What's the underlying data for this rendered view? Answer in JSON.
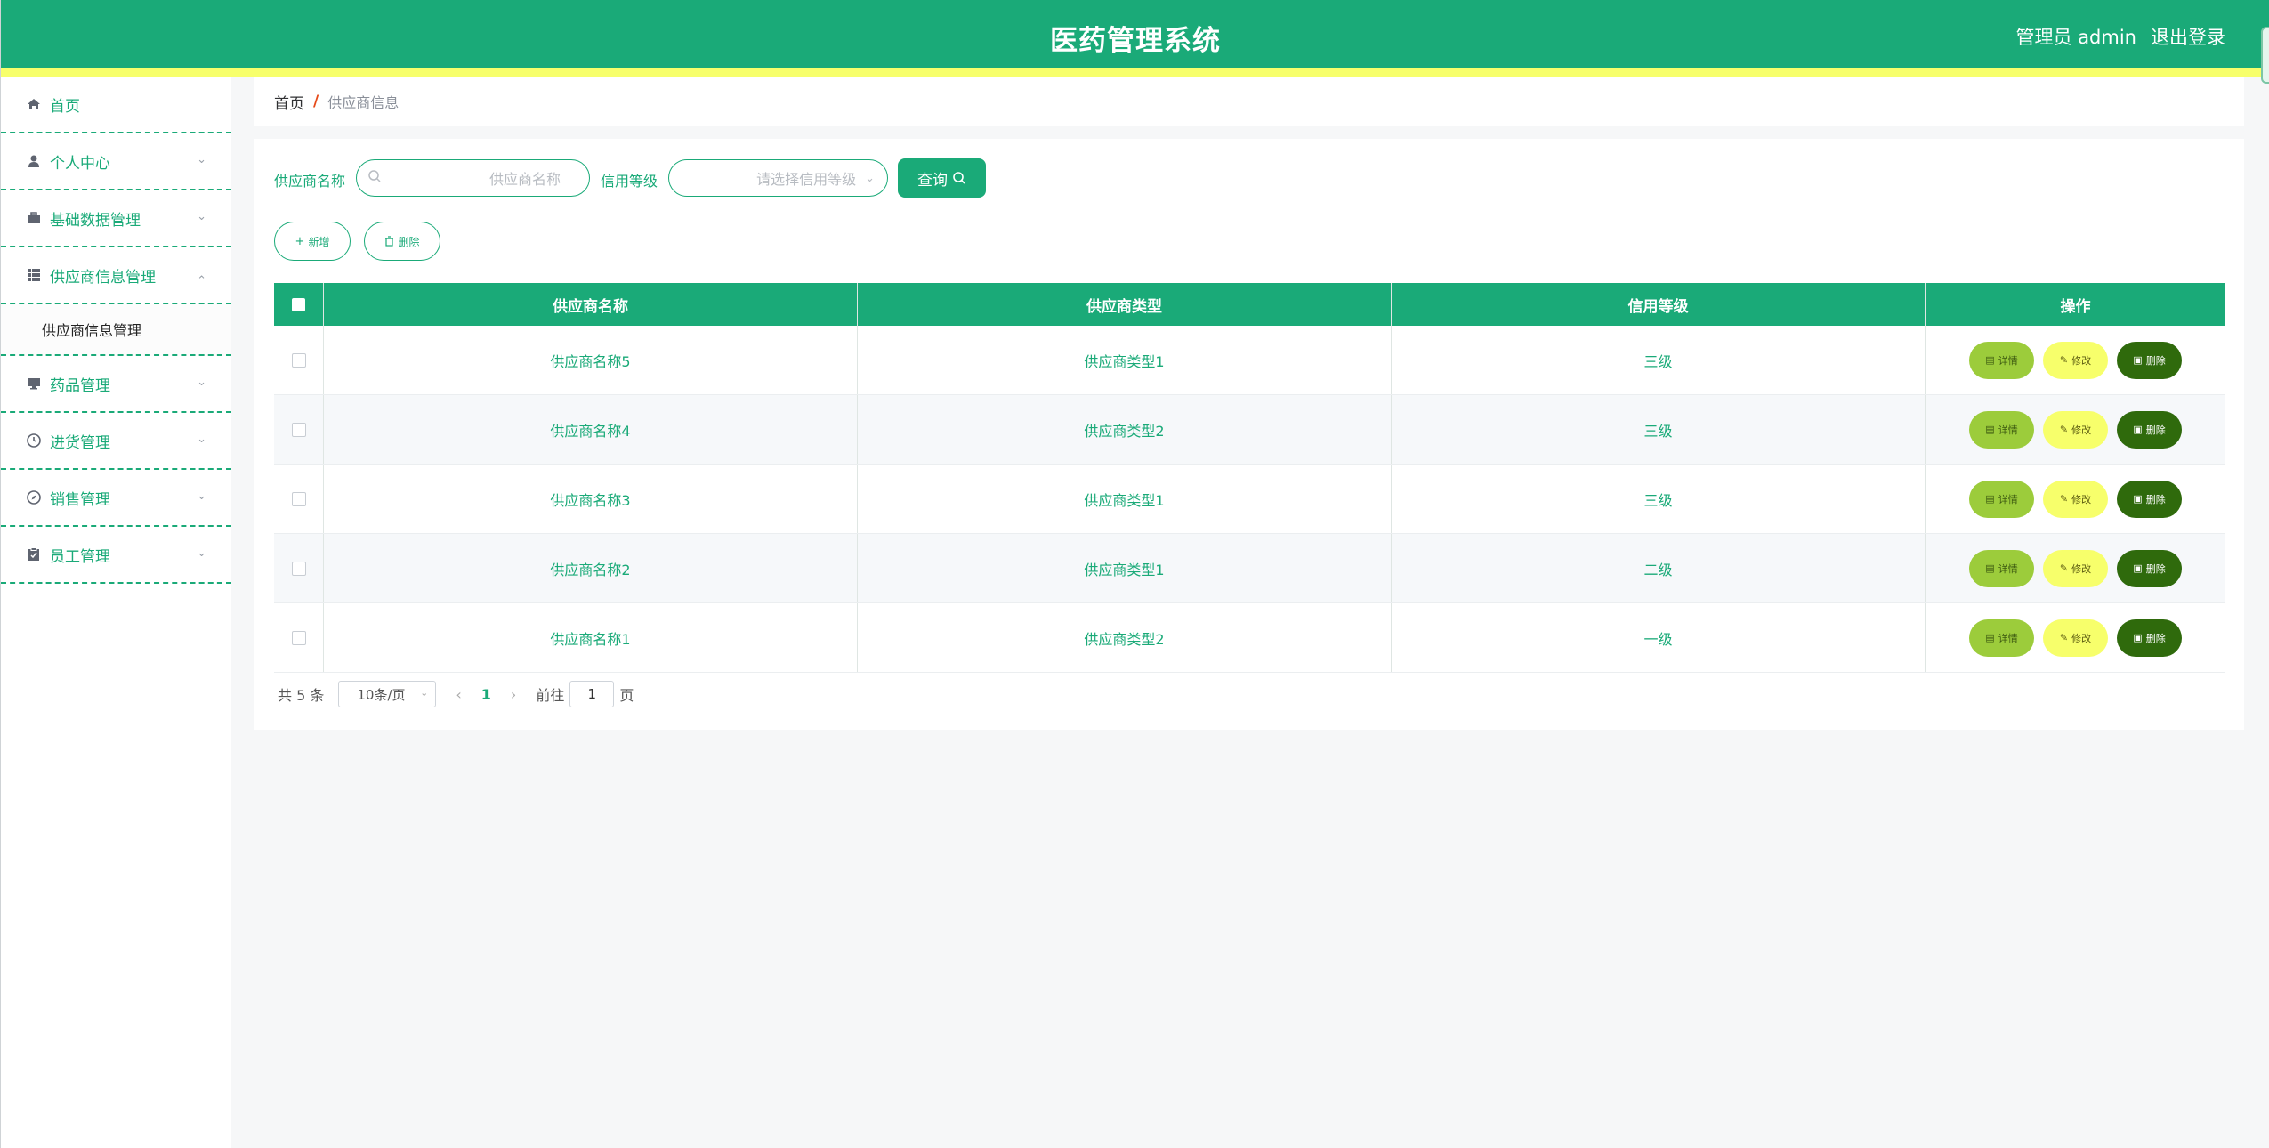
{
  "header": {
    "title": "医药管理系统",
    "user": "管理员 admin",
    "logout": "退出登录"
  },
  "sidebar": {
    "items": [
      {
        "label": "首页",
        "icon": "home-icon"
      },
      {
        "label": "个人中心",
        "icon": "user-icon"
      },
      {
        "label": "基础数据管理",
        "icon": "briefcase-icon"
      },
      {
        "label": "供应商信息管理",
        "icon": "grid-icon",
        "expanded": true,
        "children": [
          {
            "label": "供应商信息管理"
          }
        ]
      },
      {
        "label": "药品管理",
        "icon": "monitor-icon"
      },
      {
        "label": "进货管理",
        "icon": "clock-icon"
      },
      {
        "label": "销售管理",
        "icon": "compass-icon"
      },
      {
        "label": "员工管理",
        "icon": "clipboard-icon"
      }
    ]
  },
  "breadcrumb": {
    "home": "首页",
    "separator": "/",
    "current": "供应商信息"
  },
  "filters": {
    "name_label": "供应商名称",
    "name_placeholder": "供应商名称",
    "level_label": "信用等级",
    "level_placeholder": "请选择信用等级",
    "query_button": "查询"
  },
  "actions": {
    "add": "新增",
    "delete": "删除"
  },
  "table": {
    "columns": [
      "供应商名称",
      "供应商类型",
      "信用等级",
      "操作"
    ],
    "rows": [
      {
        "name": "供应商名称5",
        "type": "供应商类型1",
        "level": "三级"
      },
      {
        "name": "供应商名称4",
        "type": "供应商类型2",
        "level": "三级"
      },
      {
        "name": "供应商名称3",
        "type": "供应商类型1",
        "level": "三级"
      },
      {
        "name": "供应商名称2",
        "type": "供应商类型1",
        "level": "二级"
      },
      {
        "name": "供应商名称1",
        "type": "供应商类型2",
        "level": "一级"
      }
    ],
    "row_actions": {
      "detail": "详情",
      "edit": "修改",
      "delete": "删除"
    }
  },
  "pagination": {
    "total": "共 5 条",
    "page_size": "10条/页",
    "current": "1",
    "goto_prefix": "前往",
    "goto_value": "1",
    "goto_suffix": "页"
  },
  "colors": {
    "primary": "#1aaa78",
    "accent": "#f7ff6b",
    "detail": "#9ccc3b",
    "delete": "#2f6a0c"
  }
}
